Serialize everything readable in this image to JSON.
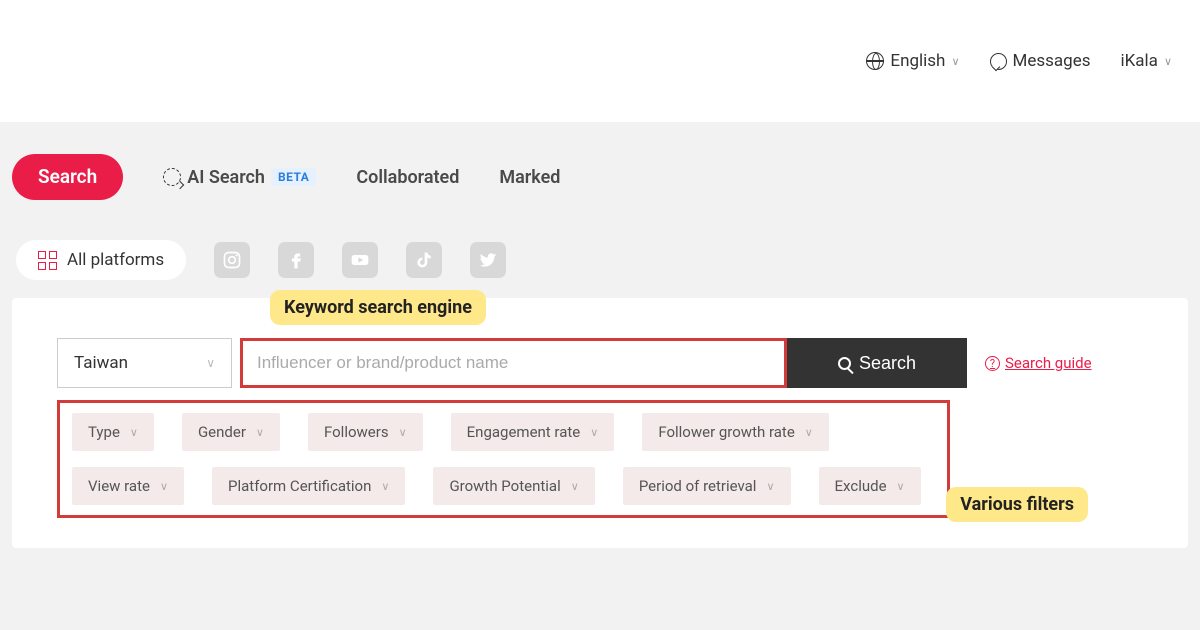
{
  "header": {
    "language": "English",
    "messages": "Messages",
    "account": "iKala"
  },
  "tabs": {
    "search": "Search",
    "ai_search": "AI Search",
    "ai_badge": "BETA",
    "collaborated": "Collaborated",
    "marked": "Marked"
  },
  "platforms": {
    "all": "All platforms"
  },
  "annotations": {
    "keyword": "Keyword search engine",
    "filters": "Various filters"
  },
  "search": {
    "region": "Taiwan",
    "placeholder": "Influencer or brand/product name",
    "button": "Search",
    "guide": "Search guide"
  },
  "filters": [
    "Type",
    "Gender",
    "Followers",
    "Engagement rate",
    "Follower growth rate",
    "View rate",
    "Platform Certification",
    "Growth Potential",
    "Period of retrieval",
    "Exclude"
  ]
}
